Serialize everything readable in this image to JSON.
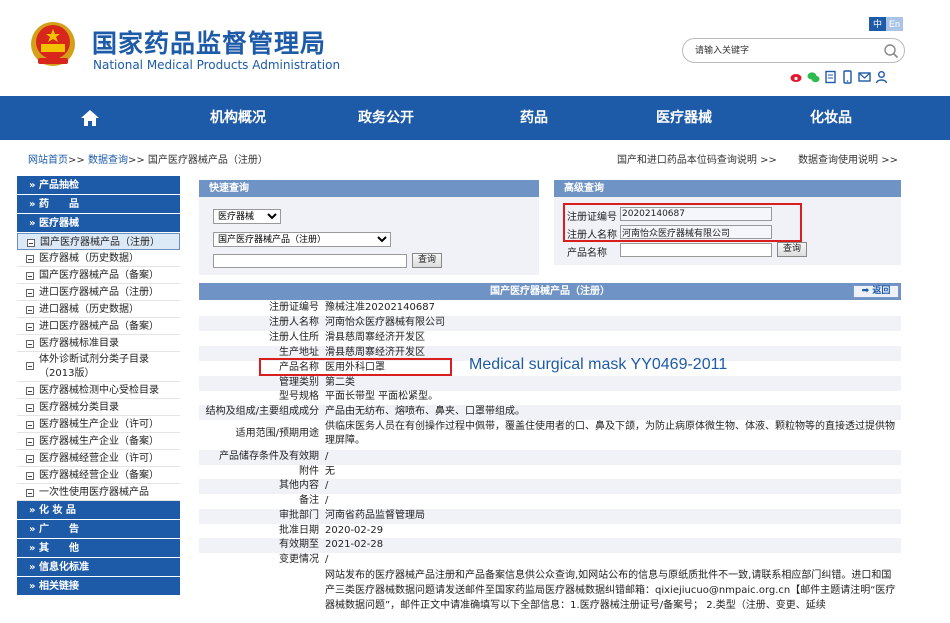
{
  "header": {
    "title_cn": "国家药品监督管理局",
    "title_en": "National Medical Products Administration",
    "lang_zh": "中",
    "lang_en": "En",
    "search_placeholder": "请输入关键字"
  },
  "colors": {
    "brand": "#1d5aa8",
    "panel": "#6f93c4",
    "highlight": "#d81e1e"
  },
  "nav": {
    "home_icon": "home-icon",
    "items": [
      "机构概况",
      "政务公开",
      "药品",
      "医疗器械",
      "化妆品"
    ]
  },
  "breadcrumb": {
    "home": "网站首页",
    "sep": ">>",
    "query": "数据查询",
    "current": "国产医疗器械产品（注册）",
    "right1": "国产和进口药品本位码查询说明 >>",
    "right2": "数据查询使用说明 >>"
  },
  "sidebar": {
    "heads_top": [
      "» 产品抽检",
      "» 药　　品",
      "» 医疗器械"
    ],
    "items": [
      "国产医疗器械产品（注册）",
      "医疗器械（历史数据）",
      "国产医疗器械产品（备案）",
      "进口医疗器械产品（注册）",
      "进口器械（历史数据）",
      "进口医疗器械产品（备案）",
      "医疗器械标准目录",
      "体外诊断试剂分类子目录（2013版）",
      "医疗器械检测中心受检目录",
      "医疗器械分类目录",
      "医疗器械生产企业（许可）",
      "医疗器械生产企业（备案）",
      "医疗器械经营企业（许可）",
      "医疗器械经营企业（备案）",
      "一次性使用医疗器械产品"
    ],
    "heads_bottom": [
      "» 化 妆 品",
      "» 广　　告",
      "» 其　　他",
      "» 信息化标准",
      "» 相关链接"
    ]
  },
  "quick_query": {
    "title": "快速查询",
    "select1": "医疗器械",
    "select2": "国产医疗器械产品（注册）",
    "input": "",
    "button": "查询"
  },
  "advanced_query": {
    "title": "高级查询",
    "label1": "注册证编号",
    "value1": "20202140687",
    "label2": "注册人名称",
    "value2": "河南怡众医疗器械有限公司",
    "label3": "产品名称",
    "value3": "",
    "button": "查询"
  },
  "detail": {
    "title": "国产医疗器械产品（注册）",
    "back": "返回",
    "rows": [
      {
        "label": "注册证编号",
        "value": "豫械注准20202140687"
      },
      {
        "label": "注册人名称",
        "value": "河南怡众医疗器械有限公司"
      },
      {
        "label": "注册人住所",
        "value": "滑县慈周寨经济开发区"
      },
      {
        "label": "生产地址",
        "value": "滑县慈周寨经济开发区"
      },
      {
        "label": "产品名称",
        "value": "医用外科口罩"
      },
      {
        "label": "管理类别",
        "value": "第二类"
      },
      {
        "label": "型号规格",
        "value": "平面长带型 平面松紧型。"
      },
      {
        "label": "结构及组成/主要组成成分",
        "value": "产品由无纺布、熔喷布、鼻夹、口罩带组成。"
      },
      {
        "label": "适用范围/预期用途",
        "value": "供临床医务人员在有创操作过程中佩带，覆盖住使用者的口、鼻及下颌，为防止病原体微生物、体液、颗粒物等的直接透过提供物理屏障。"
      },
      {
        "label": "产品储存条件及有效期",
        "value": "/"
      },
      {
        "label": "附件",
        "value": "无"
      },
      {
        "label": "其他内容",
        "value": "/"
      },
      {
        "label": "备注",
        "value": "/"
      },
      {
        "label": "审批部门",
        "value": "河南省药品监督管理局"
      },
      {
        "label": "批准日期",
        "value": "2020-02-29"
      },
      {
        "label": "有效期至",
        "value": "2021-02-28"
      },
      {
        "label": "变更情况",
        "value": "/"
      }
    ],
    "note": "网站发布的医疗器械产品注册和产品备案信息供公众查询,如网站公布的信息与原纸质批件不一致,请联系相应部门纠错。进口和国产三类医疗器械数据问题请发送邮件至国家药监局医疗器械数据纠错邮箱：qixiejiucuo@nmpaic.org.cn【邮件主题请注明“医疗器械数据问题”，邮件正文中请准确填写以下全部信息：1.医疗器械注册证号/备案号； 2.类型（注册、变更、延续"
  },
  "annotation": "Medical surgical mask YY0469-2011"
}
